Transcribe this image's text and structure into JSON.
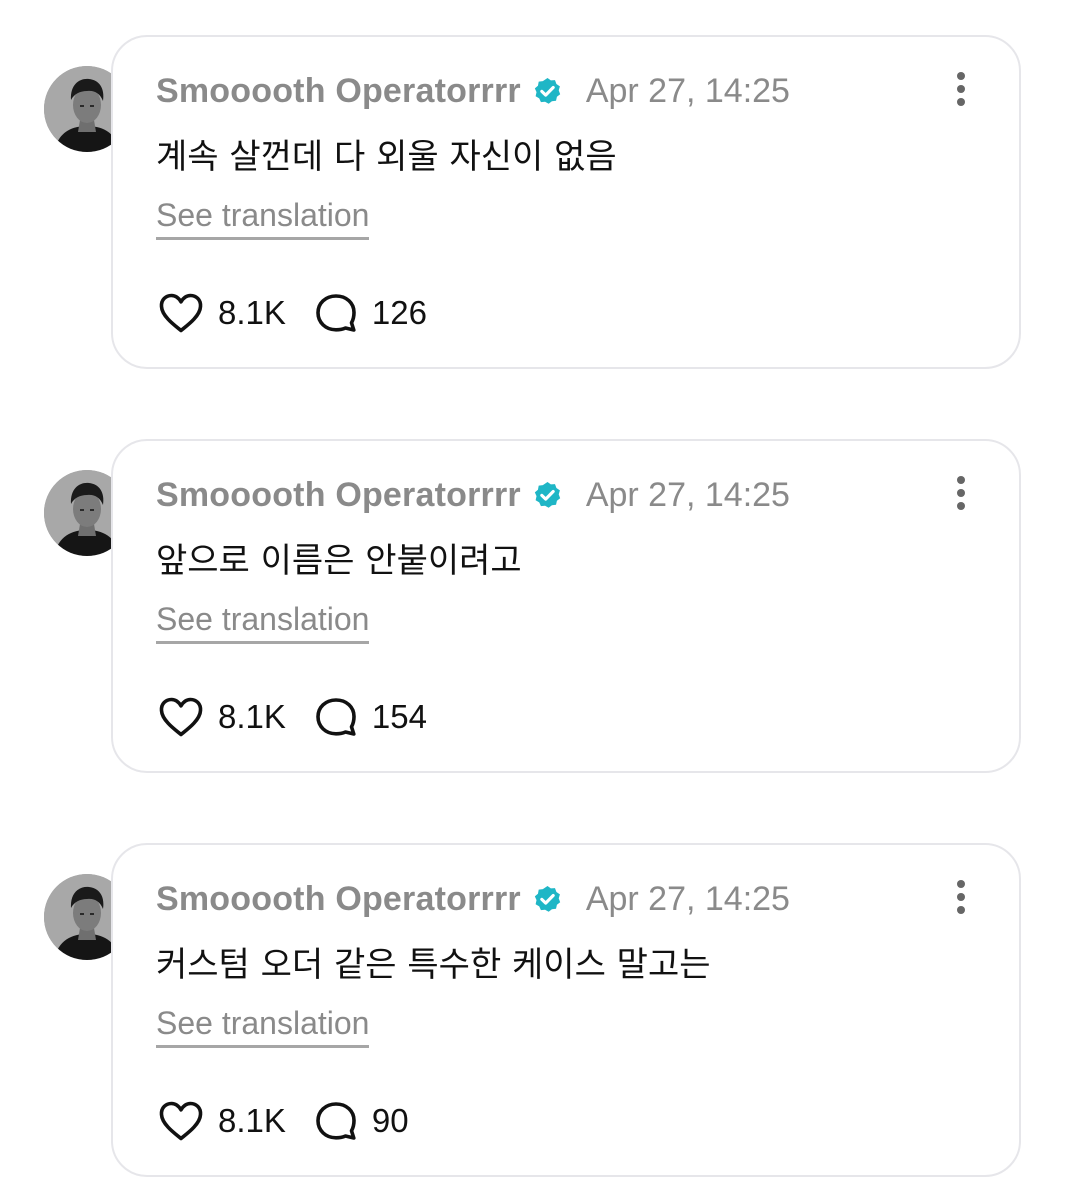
{
  "colors": {
    "verified_badge": "#1fb6c6",
    "muted_text": "#8a8a8a",
    "card_border": "#e6e6ea"
  },
  "icons": {
    "verified": "verified-badge-icon",
    "more": "more-vertical-icon",
    "like": "heart-icon",
    "reply": "speech-bubble-icon"
  },
  "posts": [
    {
      "username": "Smooooth Operatorrrr",
      "timestamp": "Apr 27, 14:25",
      "text": "계속 살껀데 다 외울 자신이 없음",
      "translation_label": "See translation",
      "likes": "8.1K",
      "replies": "126"
    },
    {
      "username": "Smooooth Operatorrrr",
      "timestamp": "Apr 27, 14:25",
      "text": "앞으로 이름은 안붙이려고",
      "translation_label": "See translation",
      "likes": "8.1K",
      "replies": "154"
    },
    {
      "username": "Smooooth Operatorrrr",
      "timestamp": "Apr 27, 14:25",
      "text": "커스텀 오더 같은 특수한 케이스 말고는",
      "translation_label": "See translation",
      "likes": "8.1K",
      "replies": "90"
    }
  ]
}
